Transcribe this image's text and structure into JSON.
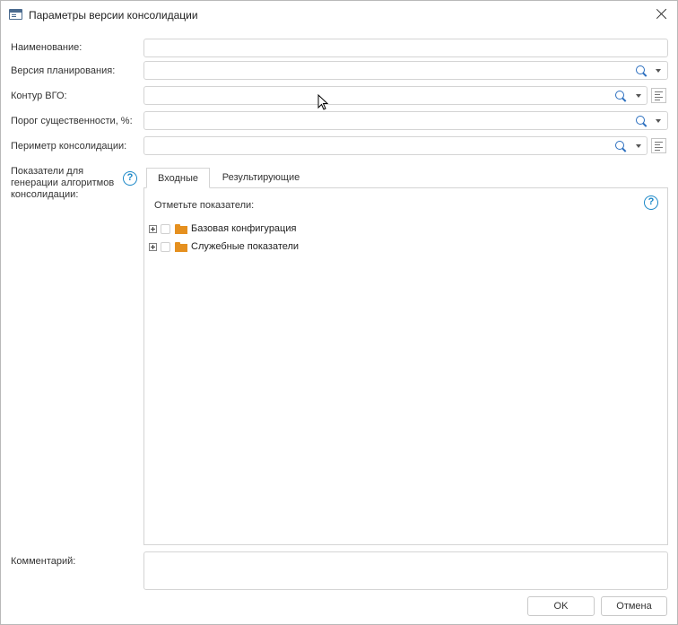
{
  "window": {
    "title": "Параметры версии консолидации"
  },
  "fields": {
    "name": {
      "label": "Наименование:",
      "value": ""
    },
    "planning_version": {
      "label": "Версия планирования:",
      "value": ""
    },
    "vgo_contour": {
      "label": "Контур ВГО:",
      "value": ""
    },
    "materiality_threshold": {
      "label": "Порог существенности, %:",
      "value": ""
    },
    "consolidation_perimeter": {
      "label": "Периметр консолидации:",
      "value": ""
    }
  },
  "indicators": {
    "label_line1": "Показатели для",
    "label_line2": "генерации алгоритмов",
    "label_line3": "консолидации:",
    "help_glyph": "?",
    "tabs": [
      {
        "label": "Входные",
        "active": true
      },
      {
        "label": "Результирующие",
        "active": false
      }
    ],
    "panel_label": "Отметьте показатели:",
    "tree": [
      {
        "label": "Базовая конфигурация",
        "checked": false
      },
      {
        "label": "Служебные показатели",
        "checked": false
      }
    ]
  },
  "comment": {
    "label": "Комментарий:",
    "value": ""
  },
  "buttons": {
    "ok": "OK",
    "cancel": "Отмена"
  },
  "colors": {
    "accent": "#1a87c7",
    "search": "#2a6ebf",
    "folder": "#e5901f",
    "border": "#d4d4d4"
  }
}
